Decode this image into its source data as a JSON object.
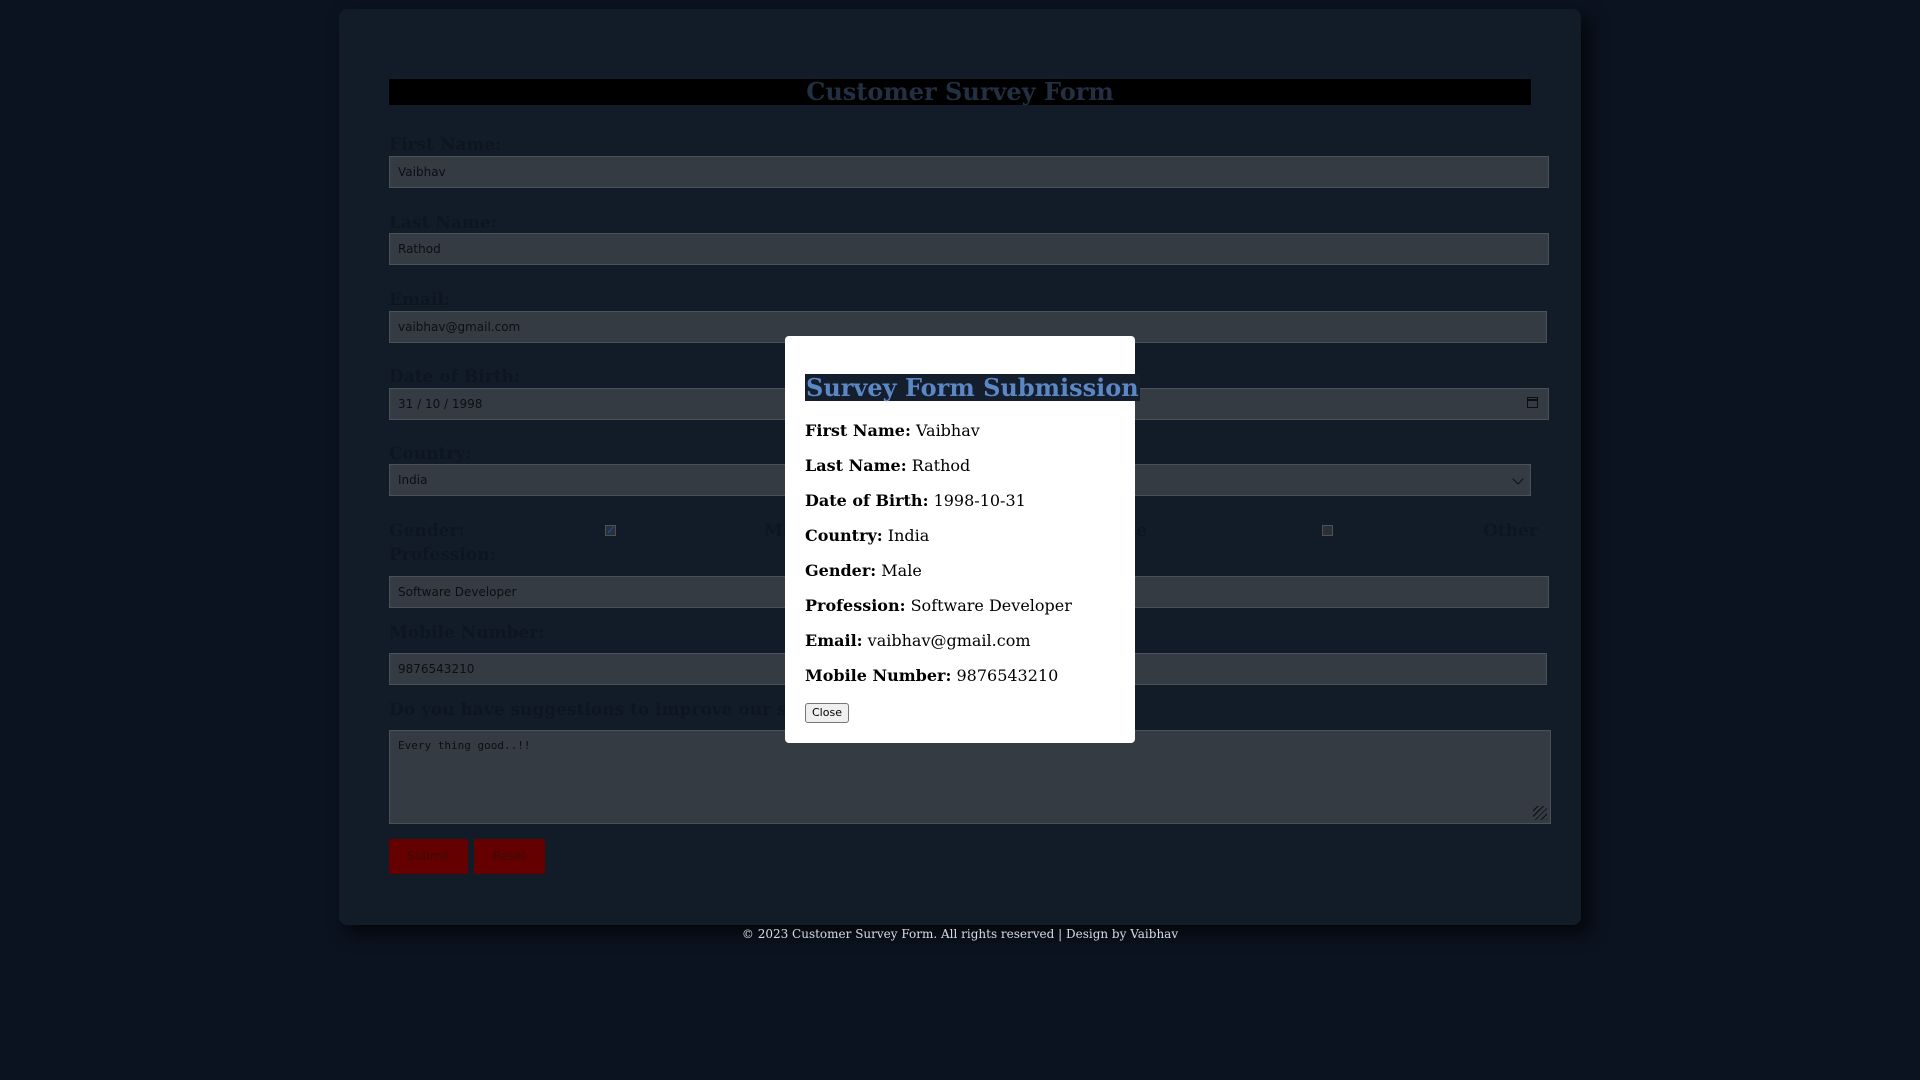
{
  "form": {
    "title": "Customer Survey Form",
    "first_name_label": "First Name:",
    "first_name_value": "Vaibhav",
    "last_name_label": "Last Name:",
    "last_name_value": "Rathod",
    "email_label": "Email:",
    "email_value": "vaibhav@gmail.com",
    "dob_label": "Date of Birth:",
    "dob_value": "31 / 10 / 1998",
    "country_label": "Country:",
    "country_value": "India",
    "gender_label": "Gender:",
    "gender_options": [
      "Male",
      "Female",
      "Other"
    ],
    "gender_checked": "Male",
    "profession_label": "Profession:",
    "profession_value": "Software Developer",
    "mobile_label": "Mobile Number:",
    "mobile_value": "9876543210",
    "suggestion_label": "Do you have suggestions to improve our service?",
    "suggestion_value": "Every thing good..!!",
    "submit_label": "Submit",
    "reset_label": "Reset"
  },
  "modal": {
    "title": "Survey Form Submission",
    "rows": [
      {
        "label": "First Name:",
        "value": "Vaibhav"
      },
      {
        "label": "Last Name:",
        "value": "Rathod"
      },
      {
        "label": "Date of Birth:",
        "value": "1998-10-31"
      },
      {
        "label": "Country:",
        "value": "India"
      },
      {
        "label": "Gender:",
        "value": "Male"
      },
      {
        "label": "Profession:",
        "value": "Software Developer"
      },
      {
        "label": "Email:",
        "value": "vaibhav@gmail.com"
      },
      {
        "label": "Mobile Number:",
        "value": "9876543210"
      }
    ],
    "close_label": "Close"
  },
  "footer": {
    "text": "© 2023 Customer Survey Form. All rights reserved | Design by Vaibhav"
  },
  "colors": {
    "page_background": "#0b1320",
    "card_background": "#121c29",
    "button_red": "#650000",
    "modal_title_text": "#5b87c5",
    "checkbox_check": "#1c4d9b"
  },
  "icons": [
    "calendar-icon",
    "chevron-down-icon",
    "checkmark-icon",
    "resize-grip-icon"
  ]
}
